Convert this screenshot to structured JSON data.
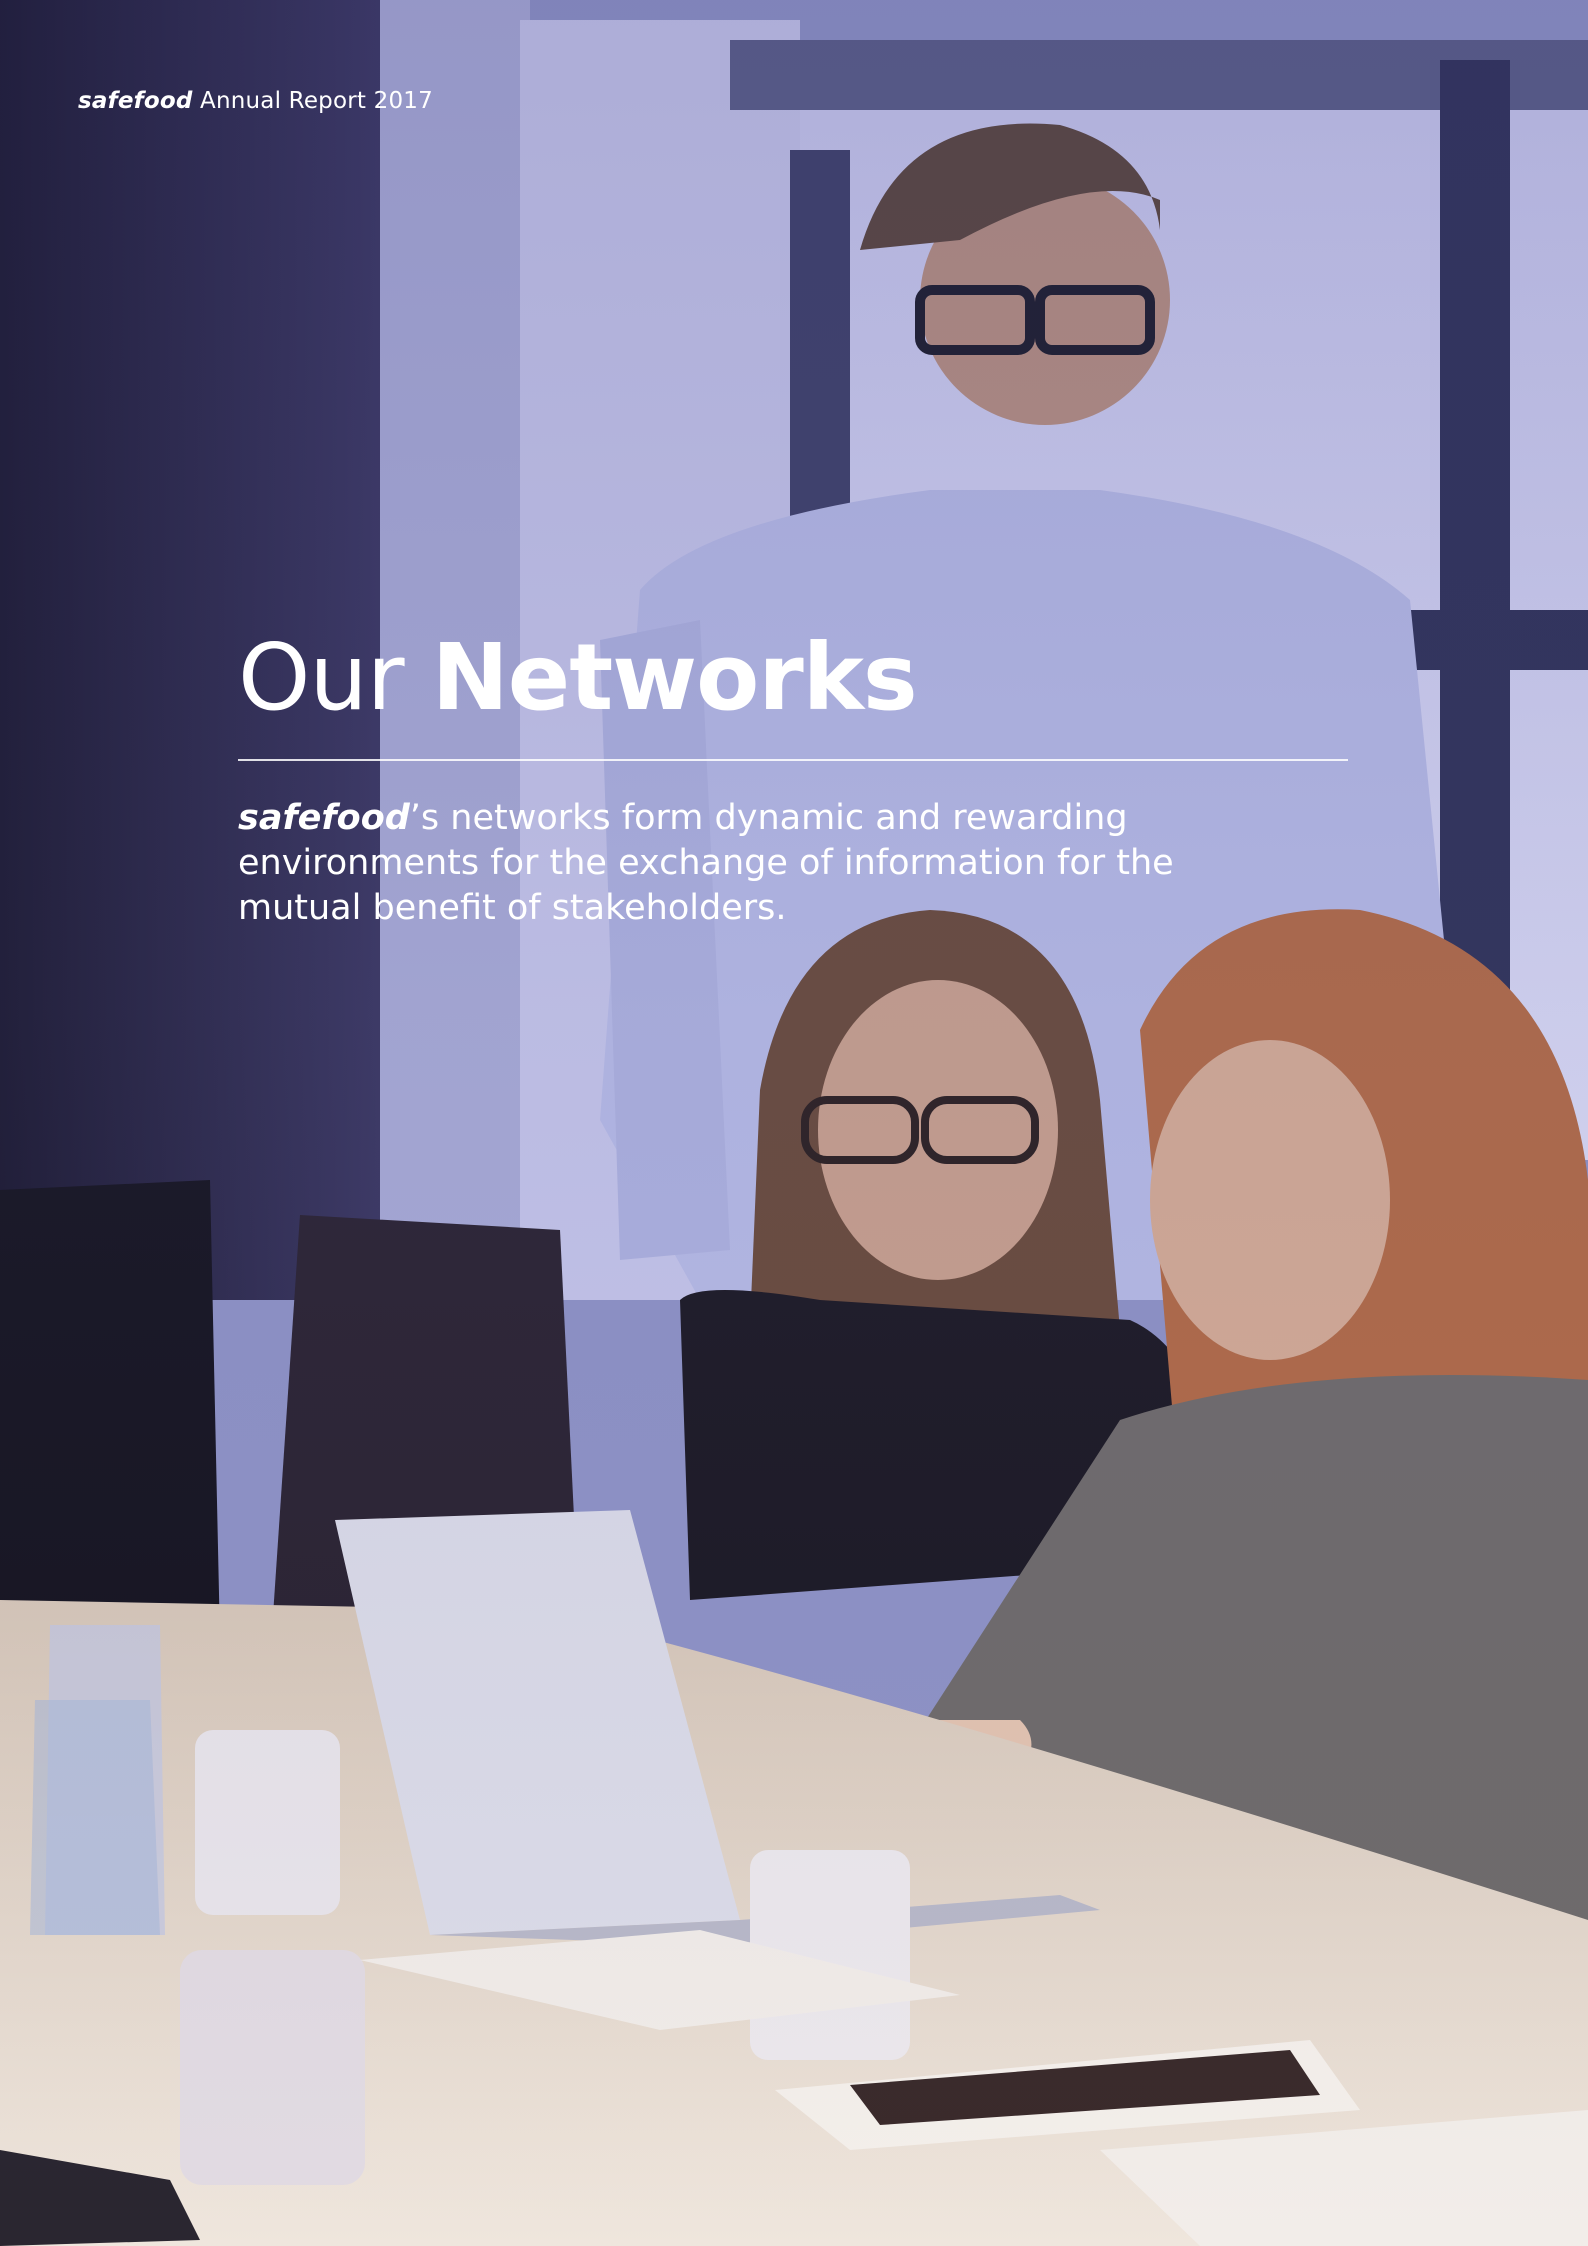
{
  "header": {
    "brand": "safefood",
    "report": "Annual Report 2017"
  },
  "title": {
    "light": "Our",
    "bold": "Networks"
  },
  "intro": {
    "brand": "safefood",
    "text": "’s networks form dynamic and rewarding environments for the exchange of information for the mutual benefit of stakeholders."
  }
}
